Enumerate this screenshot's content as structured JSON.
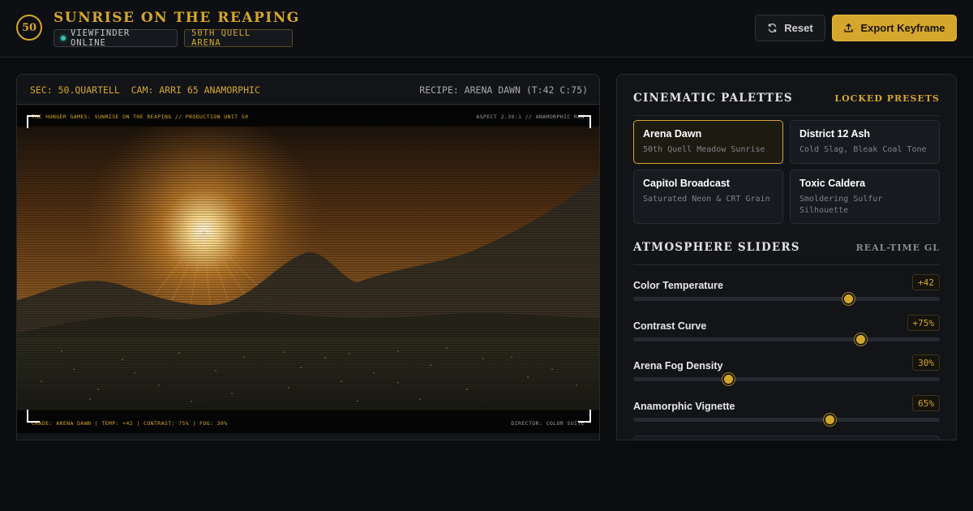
{
  "app": {
    "logo_text": "50",
    "title": "SUNRISE ON THE REAPING",
    "status_badge": "VIEWFINDER ONLINE",
    "arena_badge": "50TH QUELL ARENA",
    "reset_label": "Reset",
    "export_label": "Export Keyframe",
    "accent_color": "#d4a72c",
    "status_color": "#2ec4b6"
  },
  "viewer": {
    "left_info": "SEC: 50.QUARTELL  CAM: ARRI 65 ANAMORPHIC",
    "right_info": "RECIPE: ARENA DAWN (T:42 C:75)",
    "overlay_top_left": "THE HUNGER GAMES: SUNRISE ON THE REAPING // PRODUCTION UNIT 50",
    "overlay_top_right": "ASPECT 2.39:1 // ANAMORPHIC RAW",
    "overlay_bottom_left": "GRADE: ARENA DAWN | TEMP: +42 | CONTRAST: 75% | FOG: 30%",
    "overlay_bottom_right": "DIRECTOR: COLOR SUITE"
  },
  "palettes": {
    "title": "CINEMATIC PALETTES",
    "subtitle": "LOCKED PRESETS",
    "items": [
      {
        "name": "Arena Dawn",
        "desc": "50th Quell Meadow Sunrise",
        "active": true
      },
      {
        "name": "District 12 Ash",
        "desc": "Cold Slag, Bleak Coal Tone",
        "active": false
      },
      {
        "name": "Capitol Broadcast",
        "desc": "Saturated Neon & CRT Grain",
        "active": false
      },
      {
        "name": "Toxic Caldera",
        "desc": "Smoldering Sulfur Silhouette",
        "active": false
      }
    ]
  },
  "atmosphere": {
    "title": "ATMOSPHERE SLIDERS",
    "subtitle": "REAL-TIME GL",
    "sliders": [
      {
        "label": "Color Temperature",
        "value": "+42",
        "level": 0.7
      },
      {
        "label": "Contrast Curve",
        "value": "+75%",
        "level": 0.74
      },
      {
        "label": "Arena Fog Density",
        "value": "30%",
        "level": 0.31
      },
      {
        "label": "Anamorphic Vignette",
        "value": "65%",
        "level": 0.64
      }
    ]
  }
}
